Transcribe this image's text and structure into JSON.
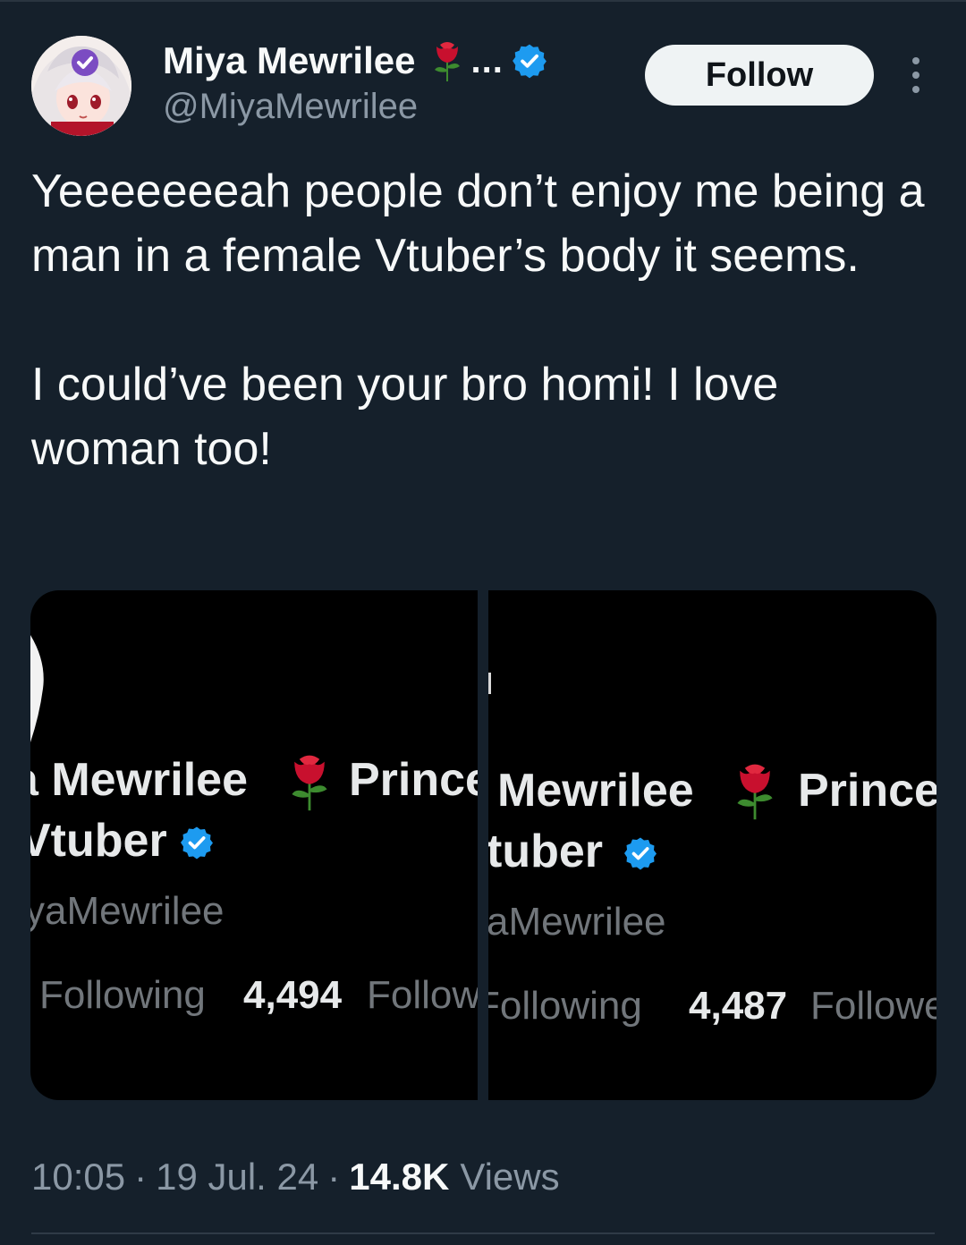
{
  "author": {
    "display_name": "Miya Mewrilee",
    "name_truncation": "...",
    "handle": "@MiyaMewrilee",
    "verified": true
  },
  "actions": {
    "follow_label": "Follow"
  },
  "tweet": {
    "text": "Yeeeeeeeah people don’t enjoy me being a man in a female Vtuber’s body it seems.\n\nI could’ve been your bro homi! I love woman too!"
  },
  "media": {
    "left": {
      "name_line": "a Mewrilee",
      "name_suffix": "Prince",
      "second_line": "Vtuber",
      "handle": "yaMewrilee",
      "following_label": "Following",
      "followers_count": "4,494",
      "followers_label": "Follow"
    },
    "right": {
      "name_line": "Mewrilee",
      "name_suffix": "Prince",
      "second_line": "tuber",
      "handle": "aMewrilee",
      "following_label": "Following",
      "followers_count": "4,487",
      "followers_label": "Followe"
    }
  },
  "meta": {
    "time": "10:05",
    "date": "19 Jul. 24",
    "views_count": "14.8K",
    "views_label": "Views"
  },
  "colors": {
    "background": "#15202b",
    "text": "#f7f9f9",
    "secondary_text": "#8b98a5",
    "verified_blue": "#1d9bf0",
    "follow_button_bg": "#eff3f4",
    "rose_red": "#c8102e"
  },
  "icons": {
    "verified": "verified-badge-icon",
    "rose": "rose-emoji-icon",
    "more": "more-options-icon"
  }
}
